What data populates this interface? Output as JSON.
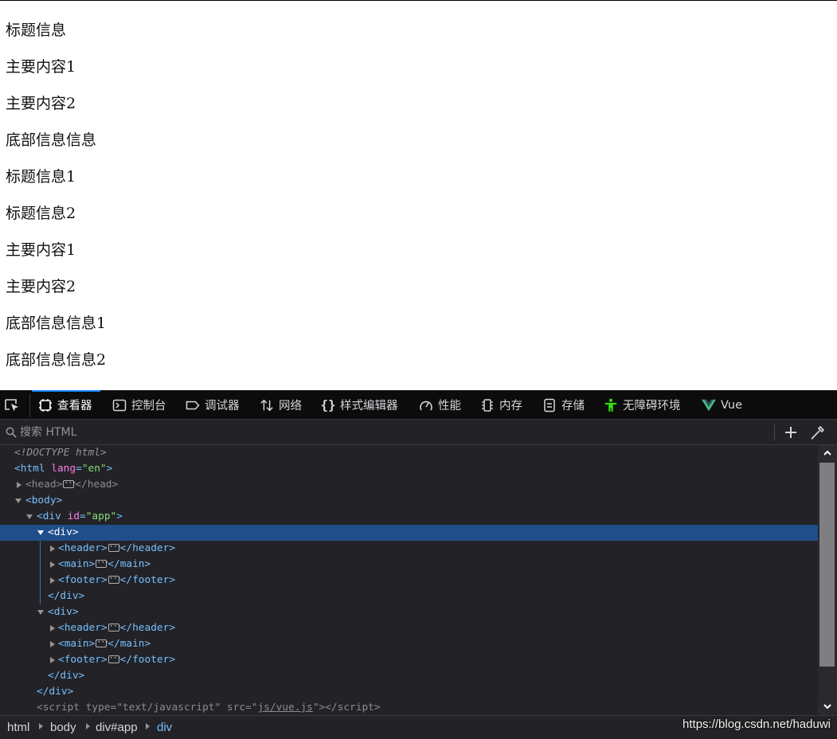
{
  "page": {
    "lines": [
      "标题信息",
      "主要内容1",
      "主要内容2",
      "底部信息信息",
      "标题信息1",
      "标题信息2",
      "主要内容1",
      "主要内容2",
      "底部信息信息1",
      "底部信息信息2"
    ]
  },
  "devtools": {
    "tabs": [
      {
        "label": "查看器",
        "icon": "inspector-icon",
        "active": true
      },
      {
        "label": "控制台",
        "icon": "console-icon"
      },
      {
        "label": "调试器",
        "icon": "debugger-icon"
      },
      {
        "label": "网络",
        "icon": "network-icon"
      },
      {
        "label": "样式编辑器",
        "icon": "style-editor-icon"
      },
      {
        "label": "性能",
        "icon": "performance-icon"
      },
      {
        "label": "内存",
        "icon": "memory-icon"
      },
      {
        "label": "存储",
        "icon": "storage-icon"
      },
      {
        "label": "无障碍环境",
        "icon": "accessibility-icon"
      },
      {
        "label": "Vue",
        "icon": "vue-icon"
      }
    ],
    "search": {
      "placeholder": "搜索 HTML"
    },
    "tree": {
      "doctype": "<!DOCTYPE html>",
      "html_tag": "html",
      "html_attr": "lang",
      "html_val": "\"en\"",
      "head_tag": "head",
      "body_tag": "body",
      "app_tag": "div",
      "app_attr": "id",
      "app_val": "\"app\"",
      "div_tag": "div",
      "header_tag": "header",
      "main_tag": "main",
      "footer_tag": "footer",
      "script_tag": "script",
      "script_type_attr": "type",
      "script_type_val": "\"text/javascript\"",
      "script_src_attr": "src",
      "script_src_val": "js/vue.js"
    },
    "breadcrumbs": [
      "html",
      "body",
      "div#app",
      "div"
    ],
    "watermark": "https://blog.csdn.net/haduwi"
  },
  "colors": {
    "selected_row": "#204e8a",
    "tag": "#75bfff",
    "attr_name": "#ff7de9",
    "attr_value": "#86de74",
    "accent": "#0a84ff"
  }
}
